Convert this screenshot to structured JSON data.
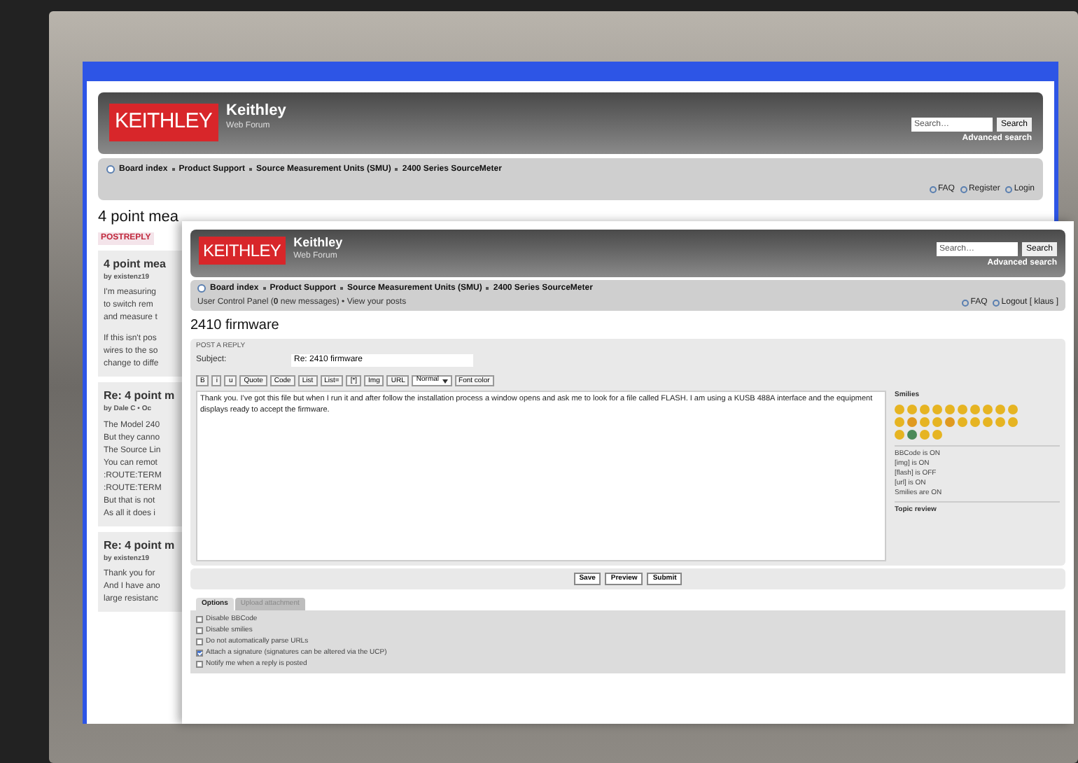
{
  "back_page": {
    "logo": "KEITHLEY",
    "site_title": "Keithley",
    "site_subtitle": "Web Forum",
    "search": {
      "placeholder": "Search…",
      "button": "Search",
      "advanced": "Advanced search"
    },
    "breadcrumb": [
      "Board index",
      "Product Support",
      "Source Measurement Units (SMU)",
      "2400 Series SourceMeter"
    ],
    "user_links": [
      "FAQ",
      "Register",
      "Login"
    ],
    "topic_title": "4 point mea",
    "post_reply": "POSTREPLY",
    "posts": [
      {
        "title": "4 point mea",
        "byline": "by existenz19",
        "paragraphs": [
          [
            "I'm measuring",
            "to switch rem",
            "and measure t"
          ],
          [
            "If this isn't pos",
            "wires to the so",
            "change to diffe"
          ]
        ]
      },
      {
        "title": "Re: 4 point m",
        "byline": "by Dale C • Oc",
        "paragraphs": [
          [
            "The Model 240",
            "But they canno",
            "The Source Lin",
            "You can remot",
            ":ROUTE:TERM",
            ":ROUTE:TERM",
            "But that is not",
            "As all it does i"
          ]
        ]
      },
      {
        "title": "Re: 4 point m",
        "byline": "by existenz19",
        "paragraphs": [
          [
            "Thank you for",
            "And I have ano",
            "large resistanc"
          ]
        ]
      }
    ]
  },
  "front_page": {
    "logo": "KEITHLEY",
    "site_title": "Keithley",
    "site_subtitle": "Web Forum",
    "search": {
      "placeholder": "Search…",
      "button": "Search",
      "advanced": "Advanced search"
    },
    "breadcrumb": [
      "Board index",
      "Product Support",
      "Source Measurement Units (SMU)",
      "2400 Series SourceMeter"
    ],
    "ucp": "User Control Panel (**0** new messages) • View your posts",
    "user_links": [
      "FAQ",
      "Logout [ klaus ]"
    ],
    "topic_title": "2410 firmware",
    "form": {
      "heading": "POST A REPLY",
      "subject_label": "Subject:",
      "subject_value": "Re: 2410 firmware",
      "toolbar": [
        {
          "kind": "button",
          "label": "B"
        },
        {
          "kind": "button",
          "label": "i"
        },
        {
          "kind": "button",
          "label": "u"
        },
        {
          "kind": "button",
          "label": "Quote"
        },
        {
          "kind": "button",
          "label": "Code"
        },
        {
          "kind": "button",
          "label": "List"
        },
        {
          "kind": "button",
          "label": "List="
        },
        {
          "kind": "button",
          "label": "[*]"
        },
        {
          "kind": "button",
          "label": "Img"
        },
        {
          "kind": "button",
          "label": "URL"
        },
        {
          "kind": "select",
          "label": "Normal"
        },
        {
          "kind": "button",
          "label": "Font color"
        }
      ],
      "message": "Thank you. I've got this file but when I run it and after follow the installation process a window opens and ask me to look for a file called FLASH. I am using a KUSB 488A interface and the equipment displays ready to accept the firmware.",
      "smilies_title": "Smilies",
      "smilies": [
        {
          "color": "#e6b422"
        },
        {
          "color": "#e6b422"
        },
        {
          "color": "#e6b422"
        },
        {
          "color": "#e6b422"
        },
        {
          "color": "#e6b422"
        },
        {
          "color": "#e6b422"
        },
        {
          "color": "#e6b422"
        },
        {
          "color": "#e6b422"
        },
        {
          "color": "#e6b422"
        },
        {
          "color": "#e6b422"
        },
        {
          "color": "#e6b422"
        },
        {
          "color": "#e09a20"
        },
        {
          "color": "#e6b422"
        },
        {
          "color": "#e6b422"
        },
        {
          "color": "#e09a20"
        },
        {
          "color": "#e6b422"
        },
        {
          "color": "#e6b422"
        },
        {
          "color": "#e6b422"
        },
        {
          "color": "#e6b422"
        },
        {
          "color": "#e6b422"
        },
        {
          "color": "#e6b422"
        },
        {
          "color": "#4a8a5a"
        },
        {
          "color": "#e6b422"
        },
        {
          "color": "#e6b422"
        }
      ],
      "status": [
        "BBCode is ON",
        "[img] is ON",
        "[flash] is OFF",
        "[url] is ON",
        "Smilies are ON"
      ],
      "topic_review": "Topic review",
      "buttons": [
        "Save",
        "Preview",
        "Submit"
      ]
    },
    "tabs": [
      {
        "label": "Options",
        "selected": true
      },
      {
        "label": "Upload attachment",
        "selected": false
      }
    ],
    "options": [
      {
        "label": "Disable BBCode",
        "checked": false
      },
      {
        "label": "Disable smilies",
        "checked": false
      },
      {
        "label": "Do not automatically parse URLs",
        "checked": false
      },
      {
        "label": "Attach a signature (signatures can be altered via the UCP)",
        "checked": true
      },
      {
        "label": "Notify me when a reply is posted",
        "checked": false
      }
    ]
  }
}
